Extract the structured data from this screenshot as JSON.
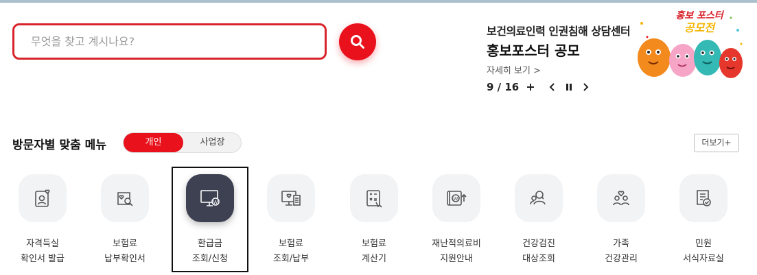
{
  "search": {
    "placeholder": "무엇을 찾고 계시나요?",
    "icon": "search-icon"
  },
  "banner": {
    "subtitle": "보건의료인력 인권침해 상담센터",
    "title": "홍보포스터 공모",
    "more_link": "자세히 보기 >",
    "counter": "9 / 16",
    "poster_line1": "홍보 포스터",
    "poster_line2": "공모전"
  },
  "visitor_menu": {
    "title": "방문자별 맞춤 메뉴",
    "tabs": [
      {
        "label": "개인",
        "active": true
      },
      {
        "label": "사업장",
        "active": false
      }
    ],
    "more_button": "더보기+",
    "items": [
      {
        "line1": "자격득실",
        "line2": "확인서 발급",
        "icon": "id-card-icon"
      },
      {
        "line1": "보험료",
        "line2": "납부확인서",
        "icon": "document-search-icon"
      },
      {
        "line1": "환급금",
        "line2": "조회/신청",
        "icon": "monitor-won-icon",
        "active": true
      },
      {
        "line1": "보험료",
        "line2": "조회/납부",
        "icon": "monitor-receipt-icon"
      },
      {
        "line1": "보험료",
        "line2": "계산기",
        "icon": "calculator-icon"
      },
      {
        "line1": "재난적의료비",
        "line2": "지원안내",
        "icon": "won-card-icon"
      },
      {
        "line1": "건강검진",
        "line2": "대상조회",
        "icon": "people-search-icon"
      },
      {
        "line1": "가족",
        "line2": "건강관리",
        "icon": "family-icon"
      },
      {
        "line1": "민원",
        "line2": "서식자료실",
        "icon": "form-check-icon"
      }
    ]
  },
  "colors": {
    "accent": "#e8111c",
    "active_icon_bg": "#3d4152",
    "icon_bg": "#f1f3f5"
  }
}
